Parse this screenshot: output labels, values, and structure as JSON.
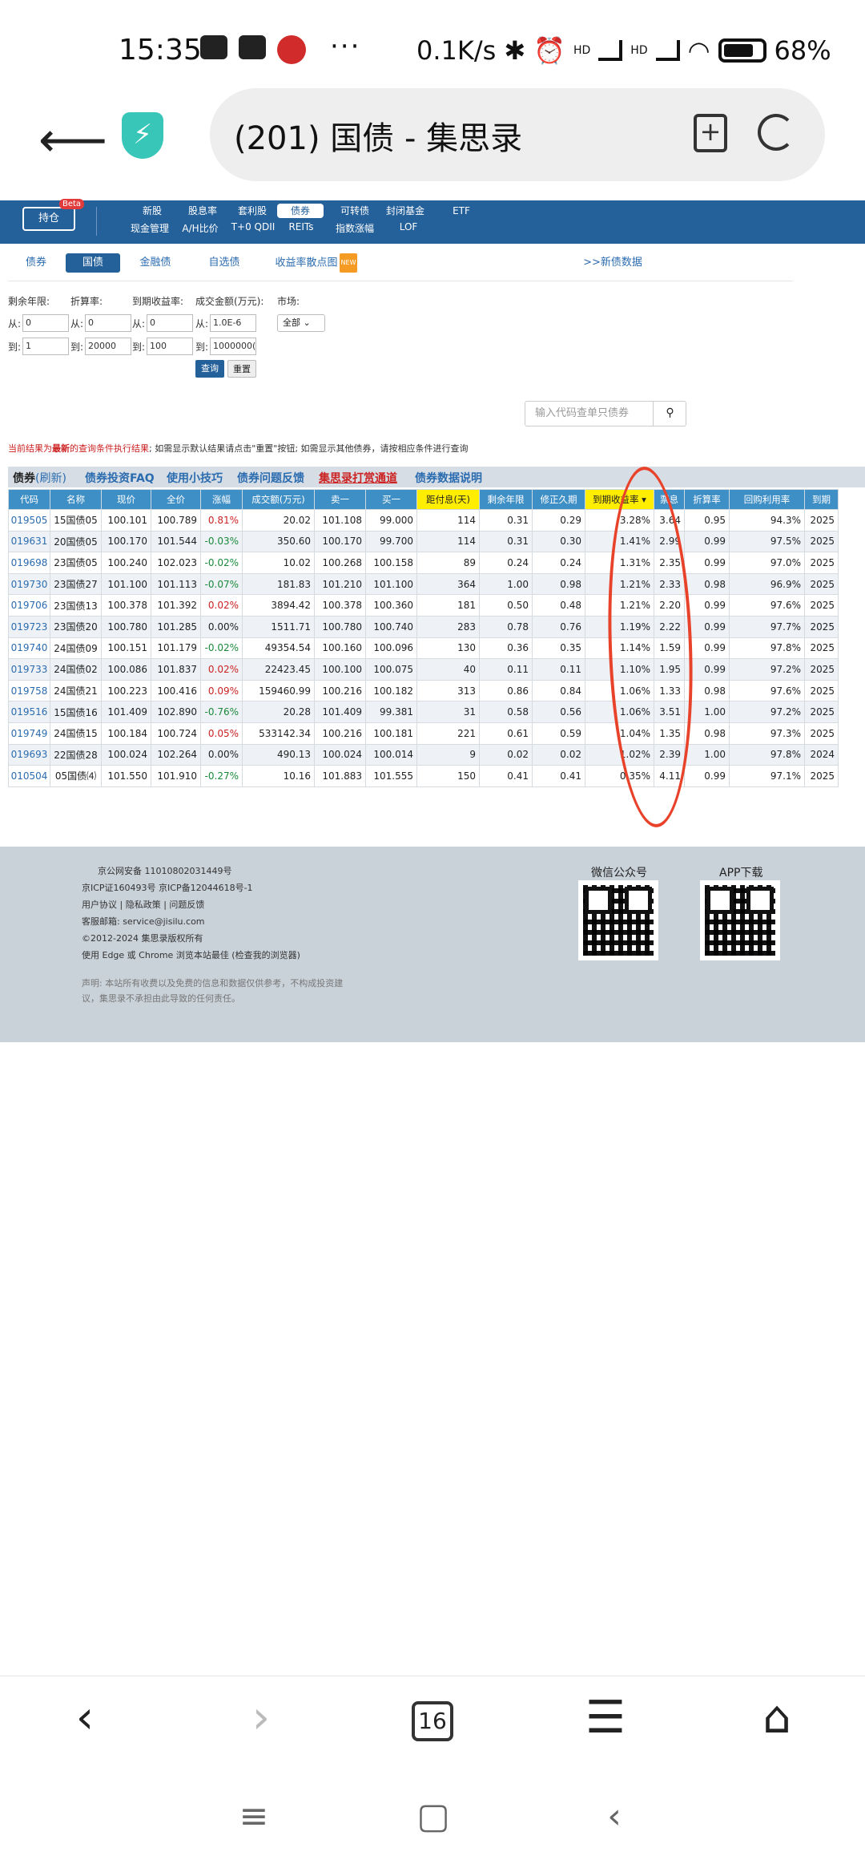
{
  "status": {
    "time": "15:35",
    "dots": "···",
    "speed": "0.1K/s",
    "net1": "HD",
    "net2": "HD",
    "battery": "68%"
  },
  "browser": {
    "title": "(201) 国债 - 集思录",
    "tab_count": "16"
  },
  "site": {
    "hold_label": "持仓",
    "beta": "Beta",
    "nav_row1": [
      "新股",
      "股息率",
      "套利股",
      "债券",
      "可转债",
      "封闭基金",
      "ETF"
    ],
    "nav_row2": [
      "现金管理",
      "A/H比价",
      "T+0 QDII",
      "REITs",
      "指数涨幅",
      "LOF"
    ],
    "active_nav": "债券"
  },
  "tabs": {
    "items": [
      "债券",
      "国债",
      "金融债",
      "自选债",
      "收益率散点图"
    ],
    "new_badge": "NEW",
    "active": "国债",
    "new_data_link": ">>新债数据"
  },
  "filters": {
    "labels": [
      "剩余年限:",
      "折算率:",
      "到期收益率:",
      "成交金额(万元):",
      "市场:"
    ],
    "from_label": "从:",
    "to_label": "到:",
    "from_values": [
      "0",
      "0",
      "0",
      "1.0E-6"
    ],
    "to_values": [
      "1",
      "20000",
      "100",
      "1000000("
    ],
    "market": "全部",
    "query": "查询",
    "reset": "重置",
    "search_placeholder": "输入代码查单只债券"
  },
  "notice": {
    "red1": "当前结果为",
    "bold": "最新",
    "red2": "的查询条件执行结果",
    "rest": "; 如需显示默认结果请点击\"重置\"按钮; 如需显示其他债券，请按相应条件进行查询"
  },
  "table_header": {
    "title": "债券",
    "refresh": "(刷新)",
    "links": [
      "债券投资FAQ",
      "使用小技巧",
      "债券问题反馈",
      "集思录打赏通道",
      "债券数据说明"
    ]
  },
  "columns": [
    "代码",
    "名称",
    "现价",
    "全价",
    "涨幅",
    "成交额(万元)",
    "卖一",
    "买一",
    "距付息(天)",
    "剩余年限",
    "修正久期",
    "到期收益率",
    "票息",
    "折算率",
    "回购利用率",
    "到期"
  ],
  "rows": [
    [
      "019505",
      "15国债05",
      "100.101",
      "100.789",
      "0.81%",
      "20.02",
      "101.108",
      "99.000",
      "114",
      "0.31",
      "0.29",
      "3.28%",
      "3.64",
      "0.95",
      "94.3%",
      "2025"
    ],
    [
      "019631",
      "20国债05",
      "100.170",
      "101.544",
      "-0.03%",
      "350.60",
      "100.170",
      "99.700",
      "114",
      "0.31",
      "0.30",
      "1.41%",
      "2.99",
      "0.99",
      "97.5%",
      "2025"
    ],
    [
      "019698",
      "23国债05",
      "100.240",
      "102.023",
      "-0.02%",
      "10.02",
      "100.268",
      "100.158",
      "89",
      "0.24",
      "0.24",
      "1.31%",
      "2.35",
      "0.99",
      "97.0%",
      "2025"
    ],
    [
      "019730",
      "23国债27",
      "101.100",
      "101.113",
      "-0.07%",
      "181.83",
      "101.210",
      "101.100",
      "364",
      "1.00",
      "0.98",
      "1.21%",
      "2.33",
      "0.98",
      "96.9%",
      "2025"
    ],
    [
      "019706",
      "23国债13",
      "100.378",
      "101.392",
      "0.02%",
      "3894.42",
      "100.378",
      "100.360",
      "181",
      "0.50",
      "0.48",
      "1.21%",
      "2.20",
      "0.99",
      "97.6%",
      "2025"
    ],
    [
      "019723",
      "23国债20",
      "100.780",
      "101.285",
      "0.00%",
      "1511.71",
      "100.780",
      "100.740",
      "283",
      "0.78",
      "0.76",
      "1.19%",
      "2.22",
      "0.99",
      "97.7%",
      "2025"
    ],
    [
      "019740",
      "24国债09",
      "100.151",
      "101.179",
      "-0.02%",
      "49354.54",
      "100.160",
      "100.096",
      "130",
      "0.36",
      "0.35",
      "1.14%",
      "1.59",
      "0.99",
      "97.8%",
      "2025"
    ],
    [
      "019733",
      "24国债02",
      "100.086",
      "101.837",
      "0.02%",
      "22423.45",
      "100.100",
      "100.075",
      "40",
      "0.11",
      "0.11",
      "1.10%",
      "1.95",
      "0.99",
      "97.2%",
      "2025"
    ],
    [
      "019758",
      "24国债21",
      "100.223",
      "100.416",
      "0.09%",
      "159460.99",
      "100.216",
      "100.182",
      "313",
      "0.86",
      "0.84",
      "1.06%",
      "1.33",
      "0.98",
      "97.6%",
      "2025"
    ],
    [
      "019516",
      "15国债16",
      "101.409",
      "102.890",
      "-0.76%",
      "20.28",
      "101.409",
      "99.381",
      "31",
      "0.58",
      "0.56",
      "1.06%",
      "3.51",
      "1.00",
      "97.2%",
      "2025"
    ],
    [
      "019749",
      "24国债15",
      "100.184",
      "100.724",
      "0.05%",
      "533142.34",
      "100.216",
      "100.181",
      "221",
      "0.61",
      "0.59",
      "1.04%",
      "1.35",
      "0.98",
      "97.3%",
      "2025"
    ],
    [
      "019693",
      "22国债28",
      "100.024",
      "102.264",
      "0.00%",
      "490.13",
      "100.024",
      "100.014",
      "9",
      "0.02",
      "0.02",
      "1.02%",
      "2.39",
      "1.00",
      "97.8%",
      "2024"
    ],
    [
      "010504",
      "05国债⑷",
      "101.550",
      "101.910",
      "-0.27%",
      "10.16",
      "101.883",
      "101.555",
      "150",
      "0.41",
      "0.41",
      "0.35%",
      "4.11",
      "0.99",
      "97.1%",
      "2025"
    ]
  ],
  "footer": {
    "lines": [
      "京公网安备 11010802031449号",
      "京ICP证160493号 京ICP备12044618号-1",
      "用户协议 | 隐私政策 | 问题反馈",
      "客服邮箱: service@jisilu.com",
      "©2012-2024 集思录版权所有",
      "使用 Edge 或 Chrome 浏览本站最佳 (检查我的浏览器)"
    ],
    "disclaimer1": "声明: 本站所有收费以及免费的信息和数据仅供参考，不构成投资建",
    "disclaimer2": "议，集思录不承担由此导致的任何责任。",
    "wechat": "微信公众号",
    "app": "APP下载"
  },
  "colors": {
    "site_blue": "#24609a",
    "header_blue": "#3f8fc7",
    "highlight": "#ffee00",
    "up_red": "#cc2222",
    "down_green": "#1a8a3a",
    "annotation": "#e8432a"
  }
}
